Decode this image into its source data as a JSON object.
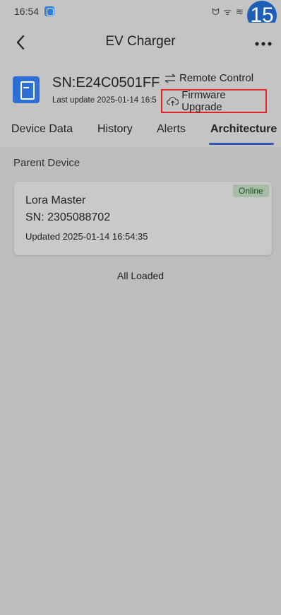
{
  "status_bar": {
    "time": "16:54",
    "right_icons": "ᗢ ᯤ ≋",
    "badge_number": "15"
  },
  "header": {
    "title": "EV Charger"
  },
  "device": {
    "sn": "SN:E24C0501FF",
    "last_update": "Last update 2025-01-14 16:5",
    "remote_control_label": "Remote Control",
    "firmware_upgrade_label": "Firmware Upgrade"
  },
  "tabs": [
    {
      "label": "Device Data"
    },
    {
      "label": "History"
    },
    {
      "label": "Alerts"
    },
    {
      "label": "Architecture"
    }
  ],
  "content": {
    "section_label": "Parent Device",
    "card": {
      "name": "Lora Master",
      "sn": "SN: 2305088702",
      "updated": "Updated 2025-01-14 16:54:35",
      "status": "Online"
    },
    "footer_text": "All Loaded"
  },
  "colors": {
    "accent": "#3158b5",
    "highlight_box": "#e02424",
    "device_icon": "#2d6fd4",
    "online_badge": "#a7bca7"
  }
}
